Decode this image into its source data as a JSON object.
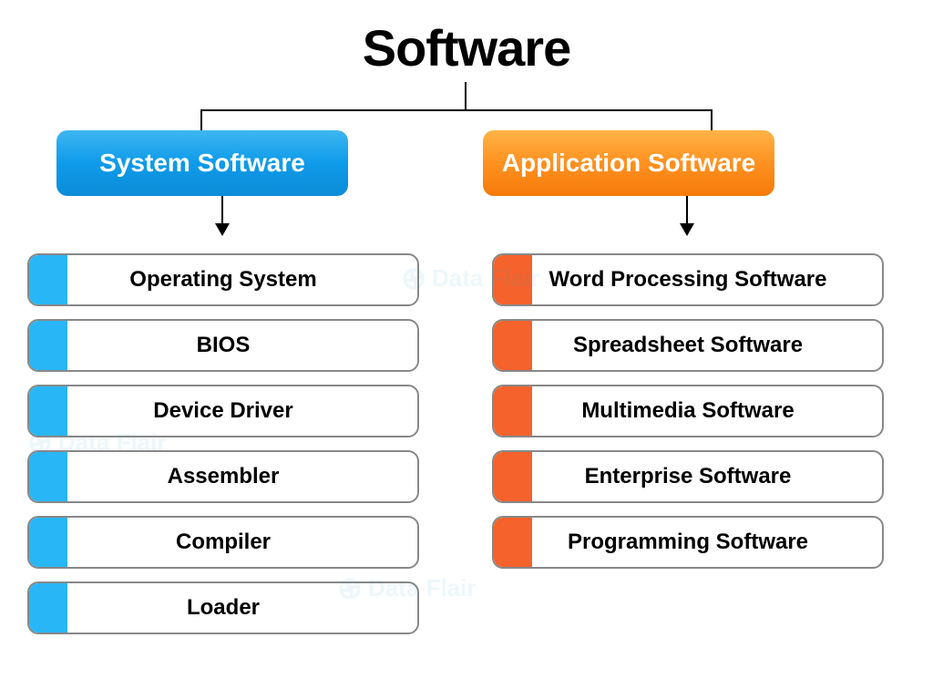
{
  "title": "Software",
  "categories": {
    "system": {
      "label": "System Software",
      "items": [
        "Operating System",
        "BIOS",
        "Device Driver",
        "Assembler",
        "Compiler",
        "Loader"
      ]
    },
    "application": {
      "label": "Application Software",
      "items": [
        "Word Processing Software",
        "Spreadsheet Software",
        "Multimedia Software",
        "Enterprise Software",
        "Programming Software"
      ]
    }
  },
  "watermark": "Data Flair",
  "colors": {
    "system_accent": "#29b6f6",
    "application_accent": "#f5622b"
  }
}
